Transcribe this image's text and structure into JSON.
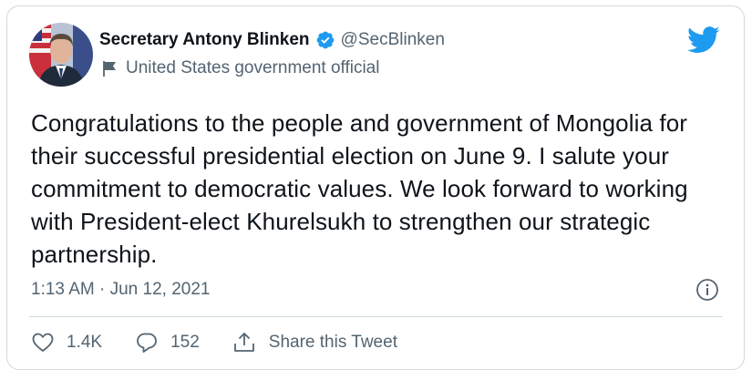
{
  "tweet": {
    "author": {
      "display_name": "Secretary Antony Blinken",
      "handle": "@SecBlinken",
      "verified": true,
      "account_label": "United States government official"
    },
    "text": "Congratulations to the people and government of Mongolia for their successful presidential election on June 9. I salute your commitment to democratic values. We look forward to working with President-elect Khurelsukh to strengthen our strategic partnership.",
    "timestamp": "1:13 AM · Jun 12, 2021",
    "actions": {
      "likes": "1.4K",
      "replies": "152",
      "share_label": "Share this Tweet"
    }
  },
  "icons": {
    "logo": "twitter-bird-icon",
    "verified": "verified-badge-icon",
    "label": "government-flag-icon",
    "info": "info-icon",
    "like": "heart-icon",
    "reply": "reply-bubble-icon",
    "share": "share-icon"
  },
  "colors": {
    "brand_blue": "#1d9bf0",
    "text_primary": "#0f1419",
    "text_secondary": "#536471",
    "border": "#cfd9de"
  }
}
